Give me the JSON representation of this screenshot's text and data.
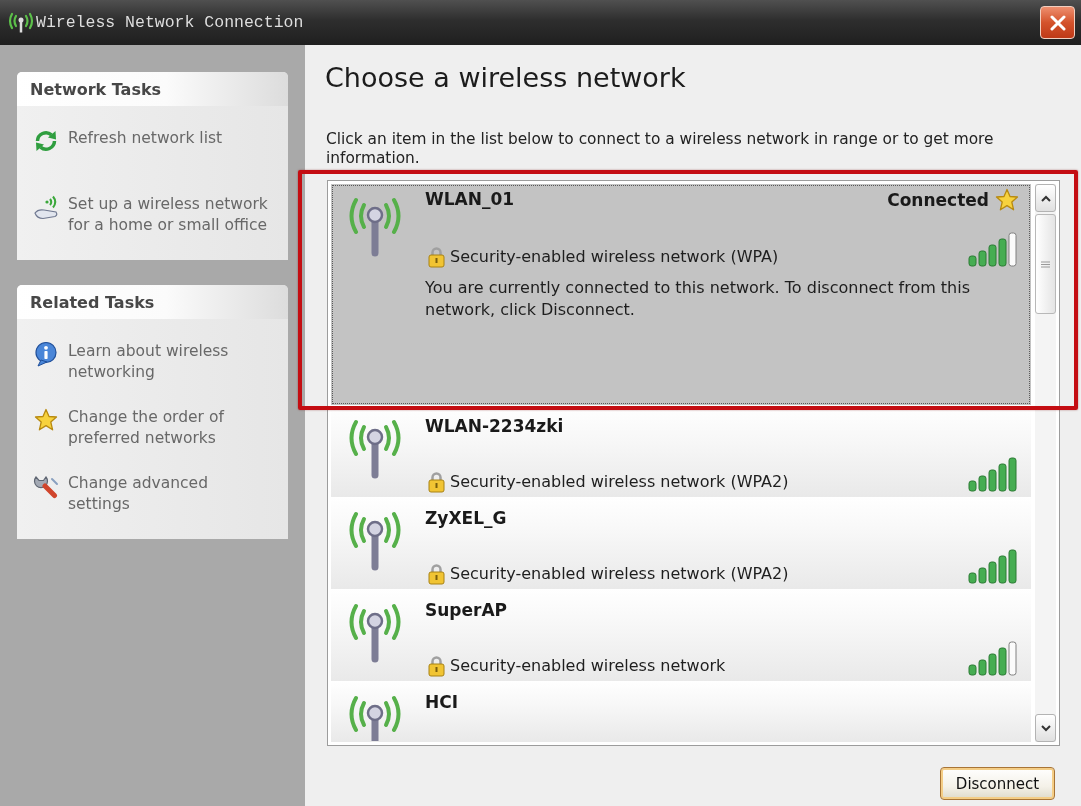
{
  "window": {
    "title": "Wireless Network Connection"
  },
  "sidebar": {
    "panels": [
      {
        "title": "Network Tasks",
        "items": [
          {
            "kind": "refresh",
            "label": "Refresh network list"
          },
          {
            "kind": "setup",
            "label": "Set up a wireless network for a home or small office"
          }
        ]
      },
      {
        "title": "Related Tasks",
        "items": [
          {
            "kind": "learn",
            "label": "Learn about wireless networking"
          },
          {
            "kind": "order",
            "label": "Change the order of preferred networks"
          },
          {
            "kind": "advanced",
            "label": "Change advanced settings"
          }
        ]
      }
    ]
  },
  "content": {
    "heading": "Choose a wireless network",
    "instructions": "Click an item in the list below to connect to a wireless network in range or to get more information."
  },
  "networks": [
    {
      "name": "WLAN_01",
      "status": "Connected",
      "preferred": true,
      "security": "Security-enabled wireless network (WPA)",
      "signal_full": false,
      "description": "You are currently connected to this network. To disconnect from this network, click Disconnect.",
      "selected": true,
      "highlighted": true
    },
    {
      "name": "WLAN-2234zki",
      "preferred": false,
      "security": "Security-enabled wireless network (WPA2)",
      "signal_full": true,
      "selected": false,
      "highlighted": false
    },
    {
      "name": "ZyXEL_G",
      "preferred": false,
      "security": "Security-enabled wireless network (WPA2)",
      "signal_full": true,
      "selected": false,
      "highlighted": false
    },
    {
      "name": "SuperAP",
      "preferred": false,
      "security": "Security-enabled wireless network",
      "signal_full": false,
      "selected": false,
      "highlighted": false
    },
    {
      "name": "HCI",
      "preferred": false,
      "selected": false,
      "highlighted": false
    }
  ],
  "buttons": [
    "Disconnect"
  ]
}
